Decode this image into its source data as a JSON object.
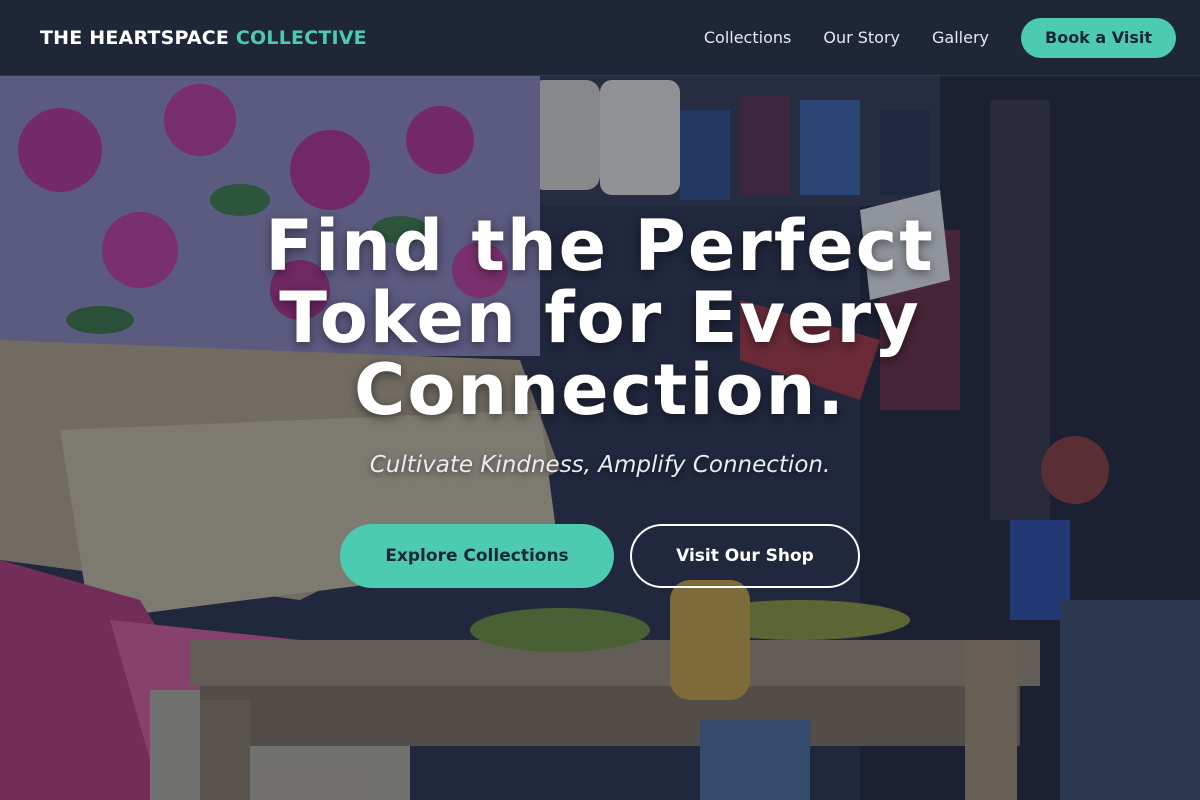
{
  "brand": {
    "name_main": "THE HEARTSPACE",
    "name_accent": "COLLECTIVE"
  },
  "nav": {
    "links": [
      "Collections",
      "Our Story",
      "Gallery"
    ],
    "cta": "Book a Visit"
  },
  "hero": {
    "headline": "Find the Perfect Token for Every Connection.",
    "tagline": "Cultivate Kindness, Amplify Connection.",
    "primary_cta": "Explore Collections",
    "secondary_cta": "Visit Our Shop",
    "background_image": "market-stall-photo"
  },
  "colors": {
    "accent": "#4ccbb0",
    "nav_bg": "#1e2638",
    "dark_text": "#1b2638"
  }
}
